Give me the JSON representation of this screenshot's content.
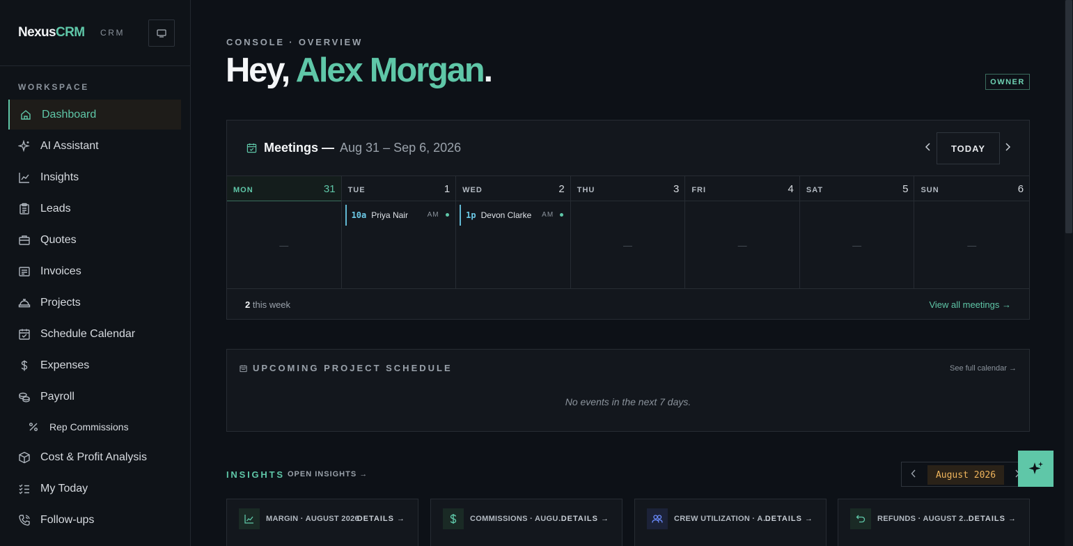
{
  "brand": {
    "name_main": "Nexus",
    "name_accent": "CRM",
    "sub": "CRM"
  },
  "sidebar": {
    "section_label": "WORKSPACE",
    "items": [
      {
        "label": "Dashboard",
        "icon": "home-icon"
      },
      {
        "label": "AI Assistant",
        "icon": "sparkles-icon"
      },
      {
        "label": "Insights",
        "icon": "chart-line-icon"
      },
      {
        "label": "Leads",
        "icon": "clipboard-icon"
      },
      {
        "label": "Quotes",
        "icon": "briefcase-icon"
      },
      {
        "label": "Invoices",
        "icon": "receipt-icon"
      },
      {
        "label": "Projects",
        "icon": "helmet-icon"
      },
      {
        "label": "Schedule Calendar",
        "icon": "calendar-check-icon"
      },
      {
        "label": "Expenses",
        "icon": "dollar-icon"
      },
      {
        "label": "Payroll",
        "icon": "coins-icon"
      },
      {
        "label": "Rep Commissions",
        "icon": "percent-icon"
      },
      {
        "label": "Cost & Profit Analysis",
        "icon": "box-icon"
      },
      {
        "label": "My Today",
        "icon": "checklist-icon"
      },
      {
        "label": "Follow-ups",
        "icon": "phone-icon"
      }
    ]
  },
  "header": {
    "eyebrow": "CONSOLE · OVERVIEW",
    "greeting": "Hey, ",
    "user_name": "Alex Morgan",
    "punct": ".",
    "role": "OWNER"
  },
  "meetings": {
    "title": "Meetings —",
    "range": "Aug 31 – Sep 6, 2026",
    "today_label": "TODAY",
    "prev": "‹",
    "next": "›",
    "days": [
      {
        "dow": "MON",
        "num": "31",
        "empty": "—"
      },
      {
        "dow": "TUE",
        "num": "1",
        "event_time": "10a",
        "event_who": "Priya Nair",
        "event_ap": "AM"
      },
      {
        "dow": "WED",
        "num": "2",
        "event_time": "1p",
        "event_who": "Devon Clarke",
        "event_ap": "AM"
      },
      {
        "dow": "THU",
        "num": "3",
        "empty": "—"
      },
      {
        "dow": "FRI",
        "num": "4",
        "empty": "—"
      },
      {
        "dow": "SAT",
        "num": "5",
        "empty": "—"
      },
      {
        "dow": "SUN",
        "num": "6",
        "empty": "—"
      }
    ],
    "count": "2",
    "count_suffix": " this week",
    "view_all": "View all meetings →"
  },
  "upcoming": {
    "title": "UPCOMING PROJECT SCHEDULE",
    "see_full": "See full calendar →",
    "empty": "No events in the next 7 days."
  },
  "insights": {
    "label": "INSIGHTS",
    "open": "OPEN INSIGHTS →",
    "month": "August 2026",
    "prev": "‹",
    "next": "›",
    "cards": [
      {
        "label": "MARGIN · AUGUST 2026",
        "details": "DETAILS →",
        "icon": "chart-icon",
        "color": "#5fc7a8"
      },
      {
        "label": "COMMISSIONS · AUGU…",
        "details": "DETAILS →",
        "icon": "dollar-icon",
        "color": "#5fc7a8"
      },
      {
        "label": "CREW UTILIZATION · A…",
        "details": "DETAILS →",
        "icon": "users-icon",
        "color": "#6b8cff"
      },
      {
        "label": "REFUNDS · AUGUST 2…",
        "details": "DETAILS →",
        "icon": "undo-icon",
        "color": "#5fc7a8"
      }
    ]
  },
  "colors": {
    "accent": "#5fc7a8",
    "amber": "#f0b55c",
    "event_bar": "#62b9d4"
  }
}
